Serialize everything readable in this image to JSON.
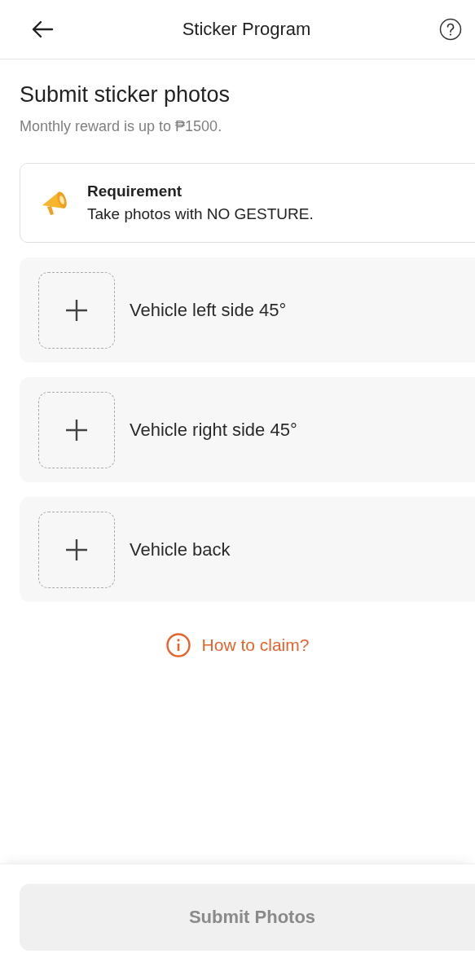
{
  "header": {
    "title": "Sticker Program"
  },
  "heading": "Submit sticker photos",
  "subtitle": "Monthly reward is up to ₱1500.",
  "requirement": {
    "title": "Requirement",
    "text": "Take photos with NO GESTURE."
  },
  "photo_slots": [
    {
      "label": "Vehicle left side 45°"
    },
    {
      "label": "Vehicle right side 45°"
    },
    {
      "label": "Vehicle back"
    }
  ],
  "help_link": "How to claim?",
  "submit_button": {
    "label": "Submit Photos",
    "disabled": true
  }
}
